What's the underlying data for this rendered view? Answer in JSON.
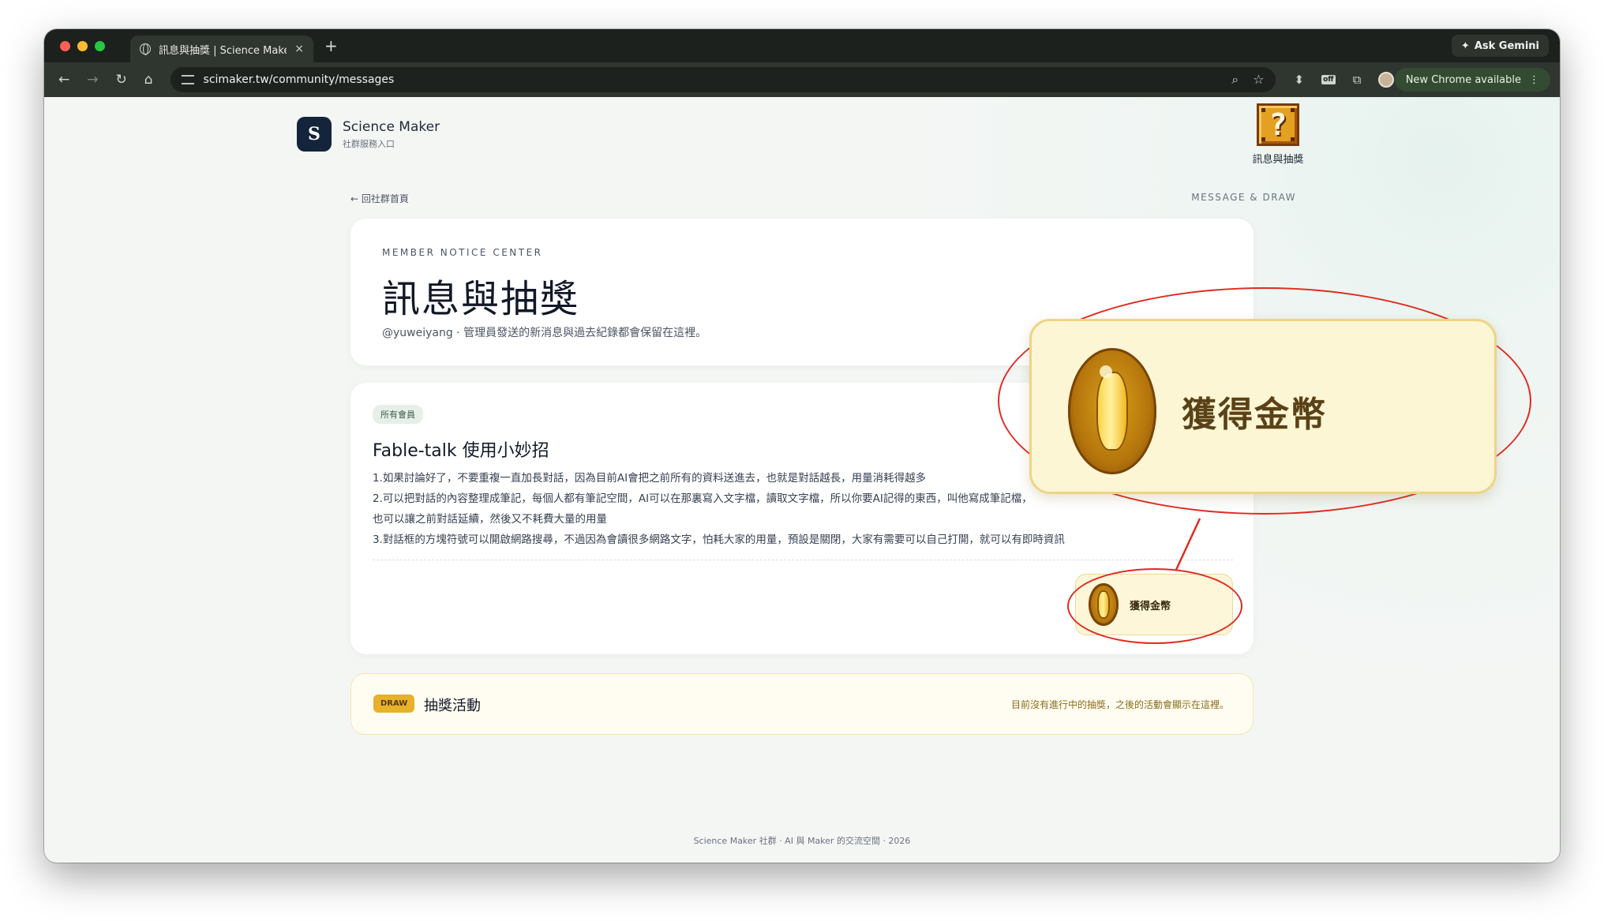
{
  "browser": {
    "tab_title": "訊息與抽獎 | Science Maker",
    "tab_close": "×",
    "new_tab": "+",
    "ask_gemini": "Ask Gemini",
    "url": "scimaker.tw/community/messages",
    "new_chrome": "New Chrome available",
    "off_badge": "off"
  },
  "brand": {
    "name": "Science Maker",
    "subtitle": "社群服務入口",
    "logo_letter": "S"
  },
  "nav_block": {
    "glyph": "?",
    "label": "訊息與抽獎"
  },
  "back_link": "← 回社群首頁",
  "section_tag": "MESSAGE & DRAW",
  "header_card": {
    "kicker": "MEMBER NOTICE CENTER",
    "title": "訊息與抽獎",
    "description": "@yuweiyang · 管理員發送的新消息與過去紀錄都會保留在這裡。"
  },
  "message_card": {
    "badge": "所有會員",
    "title": "Fable-talk 使用小妙招",
    "lines": [
      "1.如果討論好了，不要重複一直加長對話，因為目前AI會把之前所有的資料送進去，也就是對話越長，用量消耗得越多",
      "2.可以把對話的內容整理成筆記，每個人都有筆記空間，AI可以在那裏寫入文字檔，讀取文字檔，所以你要AI記得的東西，叫他寫成筆記檔，",
      "也可以讓之前對話延續，然後又不耗費大量的用量",
      "3.對話框的方塊符號可以開啟網路搜尋，不過因為會讀很多網路文字，怕耗大家的用量，預設是關閉，大家有需要可以自己打開，就可以有即時資訊"
    ],
    "coin_button_label": "獲得金幣"
  },
  "draw_card": {
    "badge": "DRAW",
    "title": "抽獎活動",
    "note": "目前沒有進行中的抽獎，之後的活動會顯示在這裡。"
  },
  "footer": "Science Maker 社群 · AI 與 Maker 的交流空間 · 2026",
  "callout": {
    "label": "獲得金幣"
  },
  "colors": {
    "accent_red": "#e02b20",
    "coin_gold": "#d9a21a",
    "brand_navy": "#14243b"
  }
}
